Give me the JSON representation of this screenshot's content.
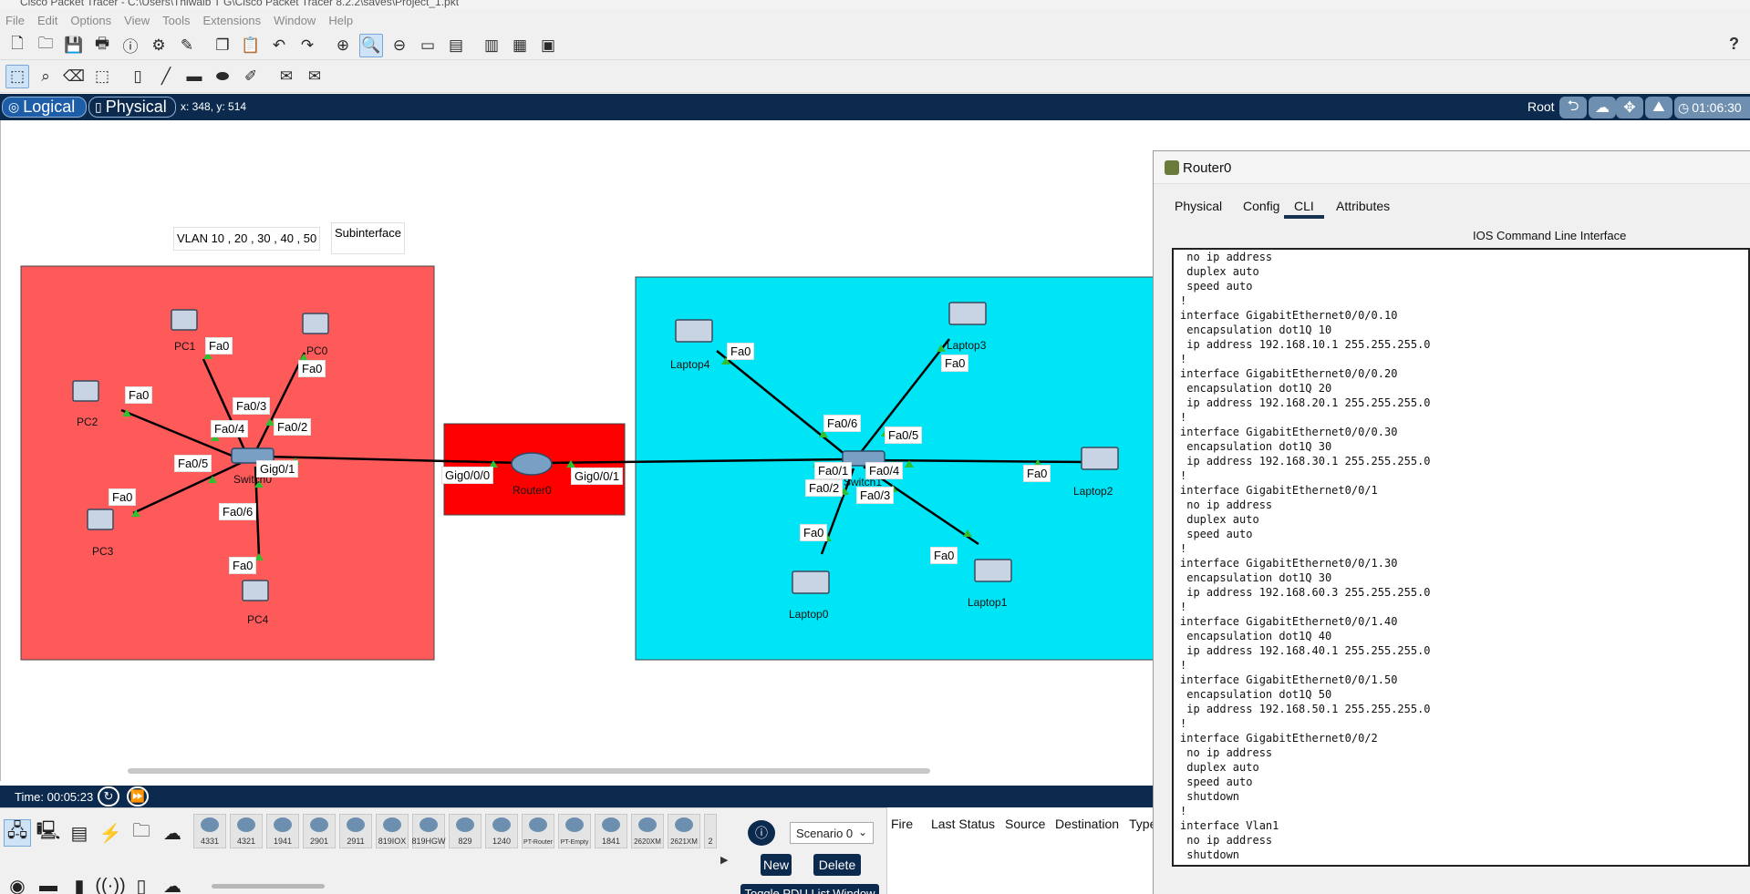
{
  "window_title": "Cisco Packet Tracer - C:\\Users\\Thiwaib T G\\Cisco Packet Tracer 8.2.2\\saves\\Project_1.pkt",
  "menu": [
    "File",
    "Edit",
    "Options",
    "View",
    "Tools",
    "Extensions",
    "Window",
    "Help"
  ],
  "workspace": {
    "logical_label": "Logical",
    "physical_label": "Physical",
    "coords": "x: 348, y: 514",
    "root_label": "Root",
    "clock": "01:06:30"
  },
  "colors": {
    "red_area": "#ff5a5a",
    "router_area": "#ff0000",
    "cyan_area": "#00e5f5",
    "bar_dark": "#0c2a4d"
  },
  "topology": {
    "notes": {
      "vlan": "VLAN 10 , 20 , 30 , 40 , 50",
      "subinterface": "Subinterface"
    },
    "devices": {
      "pc0": "PC0",
      "pc1": "PC1",
      "pc2": "PC2",
      "pc3": "PC3",
      "pc4": "PC4",
      "switch0": "Switch0",
      "router0": "Router0",
      "switch1": "Switch1",
      "laptop0": "Laptop0",
      "laptop1": "Laptop1",
      "laptop2": "Laptop2",
      "laptop3": "Laptop3",
      "laptop4": "Laptop4"
    },
    "ports": {
      "pc1_fa0": "Fa0",
      "pc0_fa0": "Fa0",
      "pc2_fa0": "Fa0",
      "pc3_fa0": "Fa0",
      "pc4_fa0": "Fa0",
      "sw0_fa03": "Fa0/3",
      "sw0_fa04": "Fa0/4",
      "sw0_fa02": "Fa0/2",
      "sw0_fa05": "Fa0/5",
      "sw0_gig01": "Gig0/1",
      "sw0_fa06": "Fa0/6",
      "r0_gig000": "Gig0/0/0",
      "r0_gig001": "Gig0/0/1",
      "lap4_fa0": "Fa0",
      "lap3_fa0": "Fa0",
      "lap2_fa0": "Fa0",
      "lap0_fa0": "Fa0",
      "lap1_fa0": "Fa0",
      "sw1_fa06": "Fa0/6",
      "sw1_fa05": "Fa0/5",
      "sw1_fa01": "Fa0/1",
      "sw1_fa04": "Fa0/4",
      "sw1_fa02": "Fa0/2",
      "sw1_fa03": "Fa0/3"
    }
  },
  "timebar": {
    "time": "Time: 00:05:23"
  },
  "device_models": [
    "4331",
    "4321",
    "1941",
    "2901",
    "2911",
    "819IOX",
    "819HGW",
    "829",
    "1240",
    "PT-Router",
    "PT-Empty",
    "1841",
    "2620XM",
    "2621XM",
    "2"
  ],
  "scenario": {
    "select_value": "Scenario 0",
    "new_label": "New",
    "delete_label": "Delete",
    "toggle_label": "Toggle PDU List Window"
  },
  "pdu_columns": [
    "Fire",
    "Last Status",
    "Source",
    "Destination",
    "Type"
  ],
  "router_window": {
    "title": "Router0",
    "tabs": [
      "Physical",
      "Config",
      "CLI",
      "Attributes"
    ],
    "active_tab": "CLI",
    "cli_header": "IOS Command Line Interface",
    "cli_lines": [
      " no ip address",
      " duplex auto",
      " speed auto",
      "!",
      "interface GigabitEthernet0/0/0.10",
      " encapsulation dot1Q 10",
      " ip address 192.168.10.1 255.255.255.0",
      "!",
      "interface GigabitEthernet0/0/0.20",
      " encapsulation dot1Q 20",
      " ip address 192.168.20.1 255.255.255.0",
      "!",
      "interface GigabitEthernet0/0/0.30",
      " encapsulation dot1Q 30",
      " ip address 192.168.30.1 255.255.255.0",
      "!",
      "interface GigabitEthernet0/0/1",
      " no ip address",
      " duplex auto",
      " speed auto",
      "!",
      "interface GigabitEthernet0/0/1.30",
      " encapsulation dot1Q 30",
      " ip address 192.168.60.3 255.255.255.0",
      "!",
      "interface GigabitEthernet0/0/1.40",
      " encapsulation dot1Q 40",
      " ip address 192.168.40.1 255.255.255.0",
      "!",
      "interface GigabitEthernet0/0/1.50",
      " encapsulation dot1Q 50",
      " ip address 192.168.50.1 255.255.255.0",
      "!",
      "interface GigabitEthernet0/0/2",
      " no ip address",
      " duplex auto",
      " speed auto",
      " shutdown",
      "!",
      "interface Vlan1",
      " no ip address",
      " shutdown"
    ]
  }
}
